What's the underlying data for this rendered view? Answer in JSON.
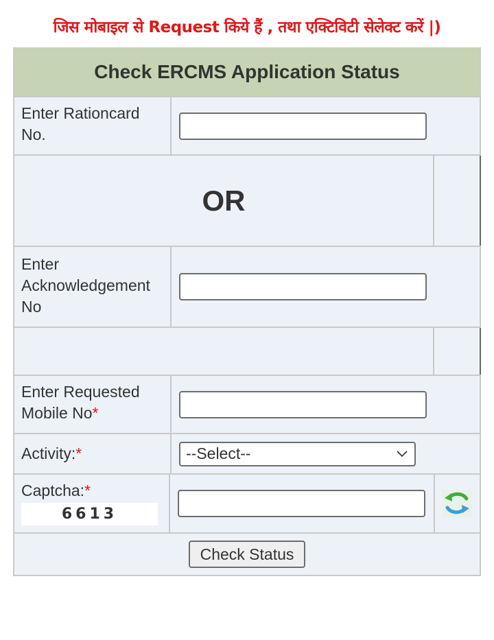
{
  "notice": "जिस मोबाइल से Request किये हैं , तथा एक्टिविटी सेलेक्ट करें |)",
  "form": {
    "title": "Check ERCMS Application Status",
    "rationcard": {
      "label": "Enter Rationcard No.",
      "value": "",
      "placeholder": ""
    },
    "or_text": "OR",
    "acknowledgement": {
      "label": "Enter Acknowledgement No",
      "value": "",
      "placeholder": ""
    },
    "mobile": {
      "label": "Enter Requested Mobile No",
      "required_mark": "*",
      "value": "",
      "placeholder": ""
    },
    "activity": {
      "label": "Activity:",
      "required_mark": "*",
      "selected": "--Select--"
    },
    "captcha": {
      "label": "Captcha:",
      "required_mark": "*",
      "code": "6613",
      "value": "",
      "refresh_icon": "refresh-icon"
    },
    "submit_label": "Check Status"
  },
  "colors": {
    "notice": "#e01818",
    "header_bg": "#c6d4b4",
    "table_bg": "#edf2f9",
    "border": "#c9c9c9"
  }
}
